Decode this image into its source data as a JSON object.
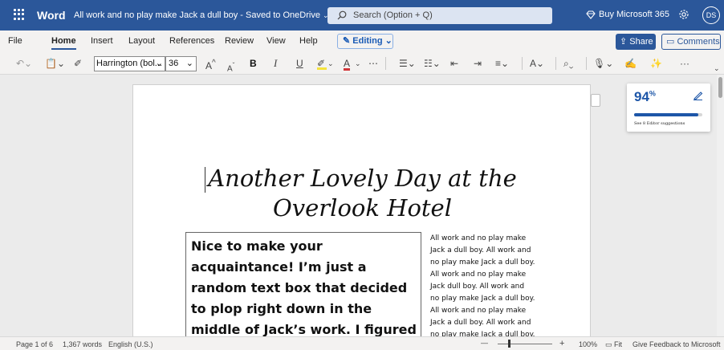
{
  "titlebar": {
    "app_name": "Word",
    "doc_title": "All work and no play make Jack a dull boy",
    "save_status": " - Saved to OneDrive",
    "search_placeholder": "Search (Option + Q)",
    "buy_label": "Buy Microsoft 365",
    "avatar_initials": "DS",
    "bg_color": "#2b579a"
  },
  "ribbon": {
    "tabs": [
      {
        "label": "File"
      },
      {
        "label": "Home"
      },
      {
        "label": "Insert"
      },
      {
        "label": "Layout"
      },
      {
        "label": "References"
      },
      {
        "label": "Review"
      },
      {
        "label": "View"
      },
      {
        "label": "Help"
      }
    ],
    "active_tab": "Home",
    "editing_label": "Editing",
    "share_label": "Share",
    "comments_label": "Comments"
  },
  "toolbar": {
    "font_name": "Harrington (bol...",
    "font_size": "36",
    "grow_font": "A",
    "shrink_font": "A",
    "bold": "B",
    "italic": "I",
    "underline": "U",
    "more": "⋯",
    "overflow": "···",
    "highlight_color": "#f5e33b",
    "font_color": "#d13438"
  },
  "document": {
    "heading_line1": "Another Lovely Day at the",
    "heading_line2": "Overlook Hotel",
    "textbox": "Nice to make your acquaintance! I’m just a random text box that decided to plop right down in the middle of Jack’s work. I figured he could use a little excitement.",
    "side_lines": [
      "All work and no play make",
      "Jack a dull boy. All work and",
      "no play make Jack a dull boy.",
      "All work and no play make",
      "Jack dull boy. All work and",
      "no play make Jack a dull boy.",
      "All work and no play make",
      "Jack a dull boy. All work and",
      "no play make Jack a dull boy."
    ]
  },
  "editor": {
    "score": "94",
    "percent_sign": "%",
    "score_fraction": 0.94,
    "suggestions": "See 8 Editor suggestions"
  },
  "statusbar": {
    "page": "Page 1 of 6",
    "words": "1,367 words",
    "language": "English (U.S.)",
    "zoom_minus": "—",
    "zoom_plus": "+",
    "zoom": "100%",
    "fit": "Fit",
    "feedback": "Give Feedback to Microsoft"
  }
}
